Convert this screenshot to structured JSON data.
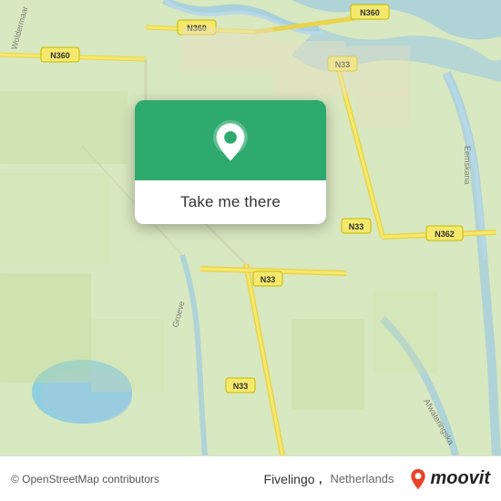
{
  "map": {
    "attribution": "© OpenStreetMap contributors",
    "background_color": "#d8e8c0"
  },
  "roads": [
    {
      "label": "N360",
      "color": "#f5c842"
    },
    {
      "label": "N33",
      "color": "#f5c842"
    },
    {
      "label": "N362",
      "color": "#f5c842"
    }
  ],
  "popup": {
    "button_label": "Take me there",
    "icon": "location-pin"
  },
  "footer": {
    "attribution": "© OpenStreetMap contributors",
    "location_name": "Fivelingo",
    "country": "Netherlands"
  },
  "moovit": {
    "name": "moovit",
    "pin_color": "#e8432d"
  }
}
